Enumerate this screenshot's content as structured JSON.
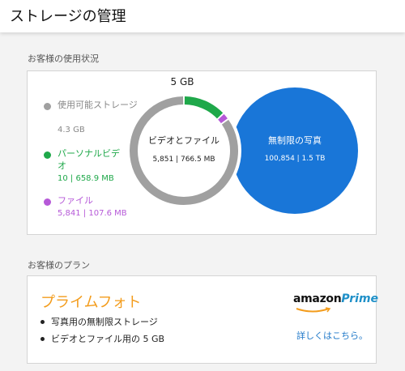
{
  "header": {
    "title": "ストレージの管理"
  },
  "usage": {
    "section_label": "お客様の使用状況",
    "legend": [
      {
        "label": "使用可能ストレージ",
        "label_line2": "ージ",
        "value": "4.3 GB",
        "color": "#a0a0a0"
      },
      {
        "label": "パーソナルビデ",
        "label_line2": "オ",
        "value": "10 | 658.9 MB",
        "color": "#1fa84a"
      },
      {
        "label": "ファイル",
        "value": "5,841 | 107.6 MB",
        "color": "#b659d8"
      }
    ],
    "ring": {
      "total_label": "5 GB",
      "center_title": "ビデオとファイル",
      "center_value": "5,851 | 766.5 MB"
    },
    "unlimited": {
      "title": "無制限の写真",
      "value": "100,854 | 1.5 TB",
      "color": "#1976d8"
    }
  },
  "plan": {
    "section_label": "お客様のプラン",
    "title": "プライムフォト",
    "features": [
      "写真用の無制限ストレージ",
      "ビデオとファイル用の 5 GB"
    ],
    "logo_text_amazon": "amazon",
    "logo_text_prime": "Prime",
    "learn_more": "詳しくはこちら。"
  },
  "chart_data": {
    "type": "pie",
    "title": "5 GB",
    "series": [
      {
        "name": "使用可能ストレージ",
        "value_gb": 4.3
      },
      {
        "name": "パーソナルビデオ",
        "value_gb": 0.6589
      },
      {
        "name": "ファイル",
        "value_gb": 0.1076
      }
    ],
    "colors": [
      "#a0a0a0",
      "#1fa84a",
      "#b659d8"
    ]
  }
}
